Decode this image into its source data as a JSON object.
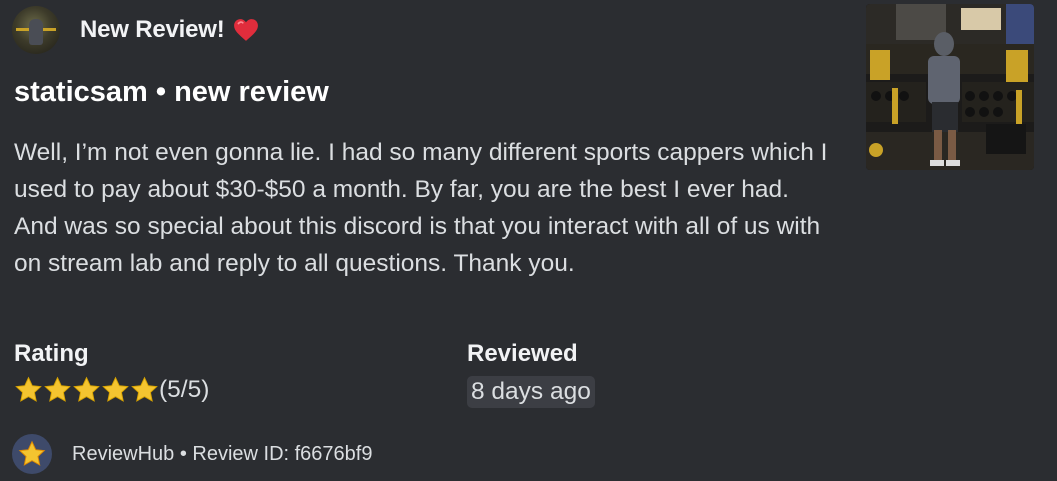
{
  "embed": {
    "author": {
      "name": "New Review!",
      "icon": "red-heart"
    },
    "title": "staticsam • new review",
    "description": "Well, I’m not even gonna lie. I had so many different sports cappers which I used to pay about $30-$50 a month. By far, you are the best I ever had. And was so special about this discord is that you interact with all of us with on stream lab and reply to all questions. Thank you.",
    "fields": {
      "rating": {
        "name": "Rating",
        "stars": 5,
        "value": "(5/5)"
      },
      "reviewed": {
        "name": "Reviewed",
        "value": "8 days ago"
      }
    },
    "footer": {
      "text": "ReviewHub • Review ID: f6676bf9",
      "icon": "star-icon"
    }
  },
  "colors": {
    "background": "#2b2d31",
    "star": "#f4c430",
    "heart": "#e02d3c",
    "chip": "#3c3e44"
  }
}
